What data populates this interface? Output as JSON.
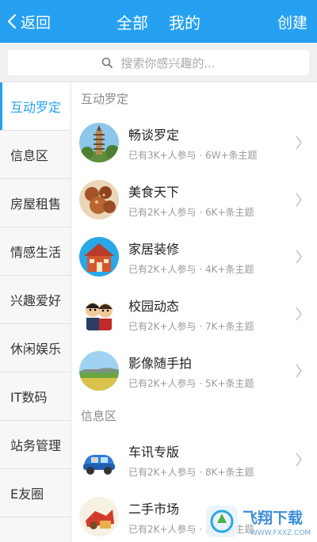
{
  "header": {
    "back_label": "返回",
    "tabs": [
      {
        "label": "全部"
      },
      {
        "label": "我的"
      }
    ],
    "create_label": "创建"
  },
  "search": {
    "placeholder": "搜索你感兴趣的..."
  },
  "sidebar": {
    "items": [
      {
        "label": "互动罗定",
        "active": true
      },
      {
        "label": "信息区"
      },
      {
        "label": "房屋租售"
      },
      {
        "label": "情感生活"
      },
      {
        "label": "兴趣爱好"
      },
      {
        "label": "休闲娱乐"
      },
      {
        "label": "IT数码"
      },
      {
        "label": "站务管理"
      },
      {
        "label": "E友圈"
      }
    ]
  },
  "sections": [
    {
      "title": "互动罗定",
      "items": [
        {
          "name": "畅谈罗定",
          "meta": "已有3K+人参与 · 6W+条主题",
          "icon": "pagoda-avatar"
        },
        {
          "name": "美食天下",
          "meta": "已有2K+人参与 · 6K+条主题",
          "icon": "food-avatar"
        },
        {
          "name": "家居装修",
          "meta": "已有2K+人参与 · 4K+条主题",
          "icon": "house-avatar"
        },
        {
          "name": "校园动态",
          "meta": "已有2K+人参与 · 7K+条主题",
          "icon": "students-avatar"
        },
        {
          "name": "影像随手拍",
          "meta": "已有2K+人参与 · 5K+条主题",
          "icon": "landscape-avatar"
        }
      ]
    },
    {
      "title": "信息区",
      "items": [
        {
          "name": "车讯专版",
          "meta": "已有2K+人参与 · 8K+条主题",
          "icon": "car-avatar"
        },
        {
          "name": "二手市场",
          "meta": "已有2K+人参与 · 2K+条主题",
          "icon": "market-avatar"
        }
      ]
    }
  ],
  "watermark": {
    "text": "飞翔下载",
    "url": "WWW.FXXZ.COM"
  },
  "colors": {
    "accent": "#26a1f1"
  }
}
